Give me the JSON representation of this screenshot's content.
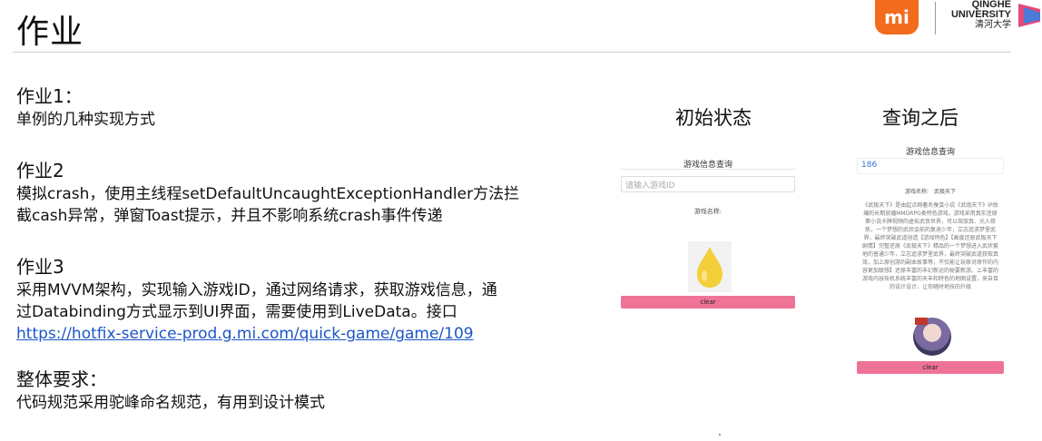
{
  "title": "作业",
  "branding": {
    "mi_logo_text": "mi",
    "university_en_line1": "QINGHE",
    "university_en_line2": "UNIVERSITY",
    "university_cn": "清河大学",
    "accent_color": "#f36b1c"
  },
  "tasks": [
    {
      "heading": "作业1：",
      "lines": [
        "单例的几种实现方式"
      ]
    },
    {
      "heading": "作业2",
      "lines": [
        "模拟crash，使用主线程setDefaultUncaughtExceptionHandler方法拦",
        "截cash异常，弹窗Toast提示，并且不影响系统crash事件传递"
      ]
    },
    {
      "heading": "作业3",
      "lines": [
        "采用MVVM架构，实现输入游戏ID，通过网络请求，获取游戏信息，通",
        "过Databinding方式显示到UI界面，需要使用到LiveData。接口"
      ],
      "link": "https://hotfix-service-prod.g.mi.com/quick-game/game/109"
    },
    {
      "heading": "整体要求：",
      "lines": [
        "代码规范采用驼峰命名规范，有用到设计模式"
      ]
    }
  ],
  "captions": {
    "initial": "初始状态",
    "after": "查询之后"
  },
  "phone_initial": {
    "title": "游戏信息查询",
    "input_placeholder": "请输入游戏ID",
    "name_label": "游戏名称:",
    "clear_label": "clear"
  },
  "phone_after": {
    "title": "游戏信息查询",
    "input_value": "186",
    "name_label": "游戏名称:　武极天下",
    "description": "《武极天下》是由起点网著名蚕茧小说《武炮天下》IP改编的长期放播MMORPG类特色游戏，游戏采用真实还原第小说卡牌视频的虚拟武侠世界，可以驾驭真、光入修炼，一个梦想的武状会前的复迪少年，立志追求梦里武界，最终突破武道创造【游戏特色】【高度还原武极天下剧情】完整还原《武极天下》精品的一个梦想进入武状套地的普通少年，立志追求梦里武界，最终突破武道获取真效，加上原创游的副本故事等，不仅能让玩家对原作的内容更加联想】还原丰富的丰幻新运的秘要新游。上丰富的游戏内容技机系统丰富的天丰和特色的地图设置，来自目的设计设计，让你随时地技的升级",
    "clear_label": "clear"
  }
}
